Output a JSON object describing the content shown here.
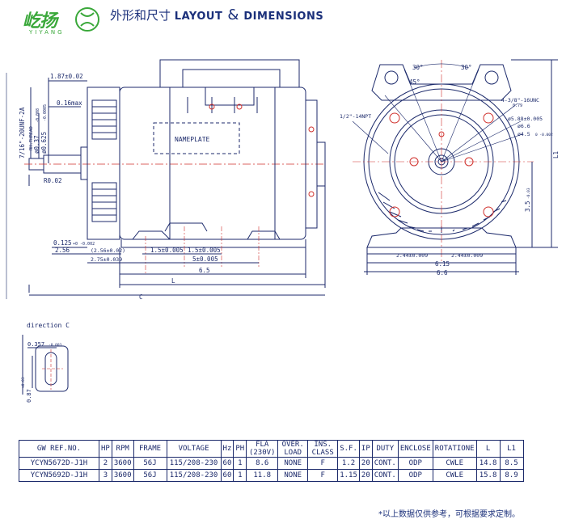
{
  "header": {
    "logo_text": "屹扬",
    "logo_sub": "YIYANG",
    "title_cn": "外形和尺寸",
    "title_en_1": "LAYOUT",
    "title_amp": "&",
    "title_en_2": "DIMENSIONS"
  },
  "side_view": {
    "dims": {
      "d187": "1.87±0.02",
      "d016": "0.16max",
      "thread": "7/16\"-20UNF-2A",
      "thread_sub": "RH.THREAD",
      "d037": "ø0.37",
      "d037_tol": "-0.008",
      "d0625": "ø0.625",
      "d0625_tol": "-0.0005",
      "r002": "R0.02",
      "d0125": "0.125",
      "d0125_tol": "+0\n-0.002",
      "d256": "2.56",
      "d256b": "(2.56±0.02)",
      "d275": "2.75±0.039",
      "d15a": "1.5±0.005",
      "d15b": "1.5±0.005",
      "d5": "5±0.005",
      "d65": "6.5",
      "dL": "L",
      "dC": "C",
      "nameplate": "NAMEPLATE"
    }
  },
  "front_view": {
    "dims": {
      "a30a": "30°",
      "a30b": "30°",
      "a45": "45°",
      "npt": "1/2\"-14NPT",
      "unc": "4-3/8\"-16UNC",
      "unc_sub": "0.79",
      "d588": "ø5.88±0.005",
      "d66": "ø6.6",
      "d45": "ø4.5",
      "d45_tol": "0\n-0.002",
      "d35": "3.5",
      "d35_tol": "-0.03",
      "d244a": "2.44±0.009",
      "d244b": "2.44±0.009",
      "d615": "6.15",
      "d66b": "6.6",
      "dL1": "L1"
    }
  },
  "direction_c": {
    "label": "direction C",
    "d0357": "0.357",
    "d0357_tol": "-0.003",
    "d087": "0.87",
    "d087_tol": "+0.03"
  },
  "spec_table": {
    "headers": [
      "GW REF.NO.",
      "HP",
      "RPM",
      "FRAME",
      "VOLTAGE",
      "Hz",
      "PH",
      "FLA (230V)",
      "OVER. LOAD",
      "INS. CLASS",
      "S.F.",
      "IP",
      "DUTY",
      "ENCLOSE",
      "ROTATIONE",
      "L",
      "L1"
    ],
    "rows": [
      [
        "YCYN5672D-J1H",
        "2",
        "3600",
        "56J",
        "115/208-230",
        "60",
        "1",
        "8.6",
        "NONE",
        "F",
        "1.2",
        "20",
        "CONT.",
        "ODP",
        "CWLE",
        "14.8",
        "8.5"
      ],
      [
        "YCYN5692D-J1H",
        "3",
        "3600",
        "56J",
        "115/208-230",
        "60",
        "1",
        "11.8",
        "NONE",
        "F",
        "1.15",
        "20",
        "CONT.",
        "ODP",
        "CWLE",
        "15.8",
        "8.9"
      ]
    ]
  },
  "note": "*以上数据仅供参考，可根据要求定制。",
  "colors": {
    "ink": "#1c2a6b",
    "accent_red": "#d0312d",
    "title_blue": "#1a2f7a",
    "logo_green": "#3aa83a"
  }
}
